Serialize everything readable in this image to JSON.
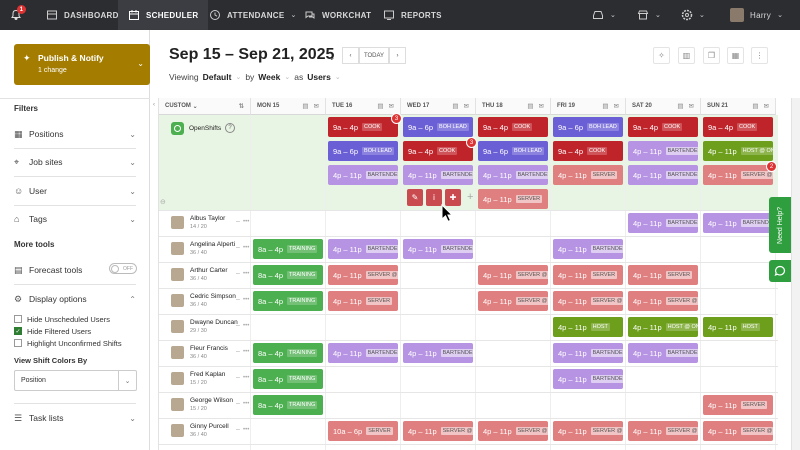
{
  "topbar": {
    "notif_count": "1",
    "nav": [
      {
        "label": "DASHBOARD",
        "icon": "dashboard-icon"
      },
      {
        "label": "SCHEDULER",
        "icon": "scheduler-icon",
        "active": true
      },
      {
        "label": "ATTENDANCE",
        "icon": "attendance-icon"
      },
      {
        "label": "WORKCHAT",
        "icon": "workchat-icon"
      },
      {
        "label": "REPORTS",
        "icon": "reports-icon"
      }
    ],
    "user_name": "Harry"
  },
  "sidebar": {
    "publish_title": "Publish & Notify",
    "publish_sub": "1 change",
    "filters_heading": "Filters",
    "filters": [
      "Positions",
      "Job sites",
      "User",
      "Tags"
    ],
    "more_tools": "More tools",
    "forecast_tools": "Forecast tools",
    "toggle_state": "OFF",
    "display_options": "Display options",
    "checks": [
      {
        "label": "Hide Unscheduled Users",
        "checked": false
      },
      {
        "label": "Hide Filtered Users",
        "checked": true
      },
      {
        "label": "Highlight Unconfirmed Shifts",
        "checked": false
      }
    ],
    "view_colors_label": "View Shift Colors By",
    "view_colors_value": "Position",
    "task_lists": "Task lists"
  },
  "header": {
    "week_title": "Sep 15 – Sep 21, 2025",
    "today": "TODAY",
    "viewing_label": "Viewing",
    "viewing_value": "Default",
    "by_label": "by",
    "by_value": "Week",
    "as_label": "as",
    "as_value": "Users"
  },
  "grid": {
    "first_col": "CUSTOM",
    "days": [
      "MON 15",
      "TUE 16",
      "WED 17",
      "THU 18",
      "FRI 19",
      "SAT 20",
      "SUN 21"
    ],
    "openshifts_label": "OpenShifts",
    "people": [
      {
        "name": "Albus Taylor",
        "hours": "14 / 20"
      },
      {
        "name": "Angelina Alperti",
        "hours": "36 / 40"
      },
      {
        "name": "Arthur Carter",
        "hours": "36 / 40"
      },
      {
        "name": "Cedric Simpson",
        "hours": "36 / 40"
      },
      {
        "name": "Dwayne Duncan",
        "hours": "29 / 30"
      },
      {
        "name": "Fleur Francis",
        "hours": "36 / 40"
      },
      {
        "name": "Fred Kaplan",
        "hours": "15 / 20"
      },
      {
        "name": "George Wilson",
        "hours": "15 / 20"
      },
      {
        "name": "Ginny Purcell",
        "hours": "36 / 40"
      }
    ]
  },
  "shifts": [
    {
      "row": -1,
      "sub": 0,
      "day": 1,
      "time": "9a – 4p",
      "tag": "COOK",
      "color": "cook",
      "badge": "3"
    },
    {
      "row": -1,
      "sub": 0,
      "day": 2,
      "time": "9a – 6p",
      "tag": "BOH LEAD",
      "color": "boh"
    },
    {
      "row": -1,
      "sub": 0,
      "day": 3,
      "time": "9a – 4p",
      "tag": "COOK",
      "color": "cook"
    },
    {
      "row": -1,
      "sub": 0,
      "day": 4,
      "time": "9a – 6p",
      "tag": "BOH LEAD",
      "color": "boh"
    },
    {
      "row": -1,
      "sub": 0,
      "day": 5,
      "time": "9a – 4p",
      "tag": "COOK",
      "color": "cook"
    },
    {
      "row": -1,
      "sub": 0,
      "day": 6,
      "time": "9a – 4p",
      "tag": "COOK",
      "color": "cook"
    },
    {
      "row": -1,
      "sub": 1,
      "day": 1,
      "time": "9a – 6p",
      "tag": "BOH LEAD",
      "color": "boh"
    },
    {
      "row": -1,
      "sub": 1,
      "day": 2,
      "time": "9a – 4p",
      "tag": "COOK",
      "color": "cook",
      "badge": "3"
    },
    {
      "row": -1,
      "sub": 1,
      "day": 3,
      "time": "9a – 6p",
      "tag": "BOH LEAD",
      "color": "boh"
    },
    {
      "row": -1,
      "sub": 1,
      "day": 4,
      "time": "9a – 4p",
      "tag": "COOK",
      "color": "cook"
    },
    {
      "row": -1,
      "sub": 1,
      "day": 5,
      "time": "4p – 11p",
      "tag": "BARTENDER",
      "color": "bart"
    },
    {
      "row": -1,
      "sub": 1,
      "day": 6,
      "time": "4p – 11p",
      "tag": "HOST @ ON",
      "color": "host"
    },
    {
      "row": -1,
      "sub": 2,
      "day": 1,
      "time": "4p – 11p",
      "tag": "BARTENDER",
      "color": "bart"
    },
    {
      "row": -1,
      "sub": 2,
      "day": 2,
      "time": "4p – 11p",
      "tag": "BARTENDER",
      "color": "bart"
    },
    {
      "row": -1,
      "sub": 2,
      "day": 3,
      "time": "4p – 11p",
      "tag": "BARTENDER",
      "color": "bart"
    },
    {
      "row": -1,
      "sub": 2,
      "day": 4,
      "time": "4p – 11p",
      "tag": "SERVER",
      "color": "serv"
    },
    {
      "row": -1,
      "sub": 2,
      "day": 5,
      "time": "4p – 11p",
      "tag": "BARTENDER",
      "color": "bart"
    },
    {
      "row": -1,
      "sub": 2,
      "day": 6,
      "time": "4p – 11p",
      "tag": "SERVER @ O",
      "color": "serv",
      "badge": "2"
    },
    {
      "row": -1,
      "sub": 3,
      "day": 3,
      "time": "4p – 11p",
      "tag": "SERVER",
      "color": "serv"
    },
    {
      "row": 0,
      "day": 5,
      "time": "4p – 11p",
      "tag": "BARTENDER",
      "color": "bart"
    },
    {
      "row": 0,
      "day": 6,
      "time": "4p – 11p",
      "tag": "BARTENDER",
      "color": "bart"
    },
    {
      "row": 1,
      "day": 0,
      "time": "8a – 4p",
      "tag": "TRAINING",
      "color": "train"
    },
    {
      "row": 1,
      "day": 1,
      "time": "4p – 11p",
      "tag": "BARTENDER",
      "color": "bart"
    },
    {
      "row": 1,
      "day": 2,
      "time": "4p – 11p",
      "tag": "BARTENDER",
      "color": "bart"
    },
    {
      "row": 1,
      "day": 4,
      "time": "4p – 11p",
      "tag": "BARTENDER",
      "color": "bart"
    },
    {
      "row": 2,
      "day": 0,
      "time": "8a – 4p",
      "tag": "TRAINING",
      "color": "train"
    },
    {
      "row": 2,
      "day": 1,
      "time": "4p – 11p",
      "tag": "SERVER @ Y",
      "color": "serv"
    },
    {
      "row": 2,
      "day": 3,
      "time": "4p – 11p",
      "tag": "SERVER @ Y",
      "color": "serv"
    },
    {
      "row": 2,
      "day": 4,
      "time": "4p – 11p",
      "tag": "SERVER",
      "color": "serv"
    },
    {
      "row": 2,
      "day": 5,
      "time": "4p – 11p",
      "tag": "SERVER",
      "color": "serv"
    },
    {
      "row": 3,
      "day": 0,
      "time": "8a – 4p",
      "tag": "TRAINING",
      "color": "train"
    },
    {
      "row": 3,
      "day": 1,
      "time": "4p – 11p",
      "tag": "SERVER",
      "color": "serv"
    },
    {
      "row": 3,
      "day": 3,
      "time": "4p – 11p",
      "tag": "SERVER @ Y",
      "color": "serv"
    },
    {
      "row": 3,
      "day": 4,
      "time": "4p – 11p",
      "tag": "SERVER @ Y",
      "color": "serv"
    },
    {
      "row": 3,
      "day": 5,
      "time": "4p – 11p",
      "tag": "SERVER @ Y",
      "color": "serv"
    },
    {
      "row": 4,
      "day": 4,
      "time": "4p – 11p",
      "tag": "HOST",
      "color": "host"
    },
    {
      "row": 4,
      "day": 5,
      "time": "4p – 11p",
      "tag": "HOST @ ON",
      "color": "host"
    },
    {
      "row": 4,
      "day": 6,
      "time": "4p – 11p",
      "tag": "HOST",
      "color": "host"
    },
    {
      "row": 5,
      "day": 0,
      "time": "8a – 4p",
      "tag": "TRAINING",
      "color": "train"
    },
    {
      "row": 5,
      "day": 1,
      "time": "4p – 11p",
      "tag": "BARTENDER",
      "color": "bart"
    },
    {
      "row": 5,
      "day": 2,
      "time": "4p – 11p",
      "tag": "BARTENDER",
      "color": "bart"
    },
    {
      "row": 5,
      "day": 4,
      "time": "4p – 11p",
      "tag": "BARTENDER",
      "color": "bart"
    },
    {
      "row": 5,
      "day": 5,
      "time": "4p – 11p",
      "tag": "BARTENDER",
      "color": "bart"
    },
    {
      "row": 6,
      "day": 0,
      "time": "8a – 4p",
      "tag": "TRAINING",
      "color": "train"
    },
    {
      "row": 6,
      "day": 4,
      "time": "4p – 11p",
      "tag": "BARTENDER",
      "color": "bart"
    },
    {
      "row": 7,
      "day": 0,
      "time": "8a – 4p",
      "tag": "TRAINING",
      "color": "train"
    },
    {
      "row": 7,
      "day": 6,
      "time": "4p – 11p",
      "tag": "SERVER",
      "color": "serv"
    },
    {
      "row": 8,
      "day": 1,
      "time": "10a – 6p",
      "tag": "SERVER",
      "color": "serv"
    },
    {
      "row": 8,
      "day": 2,
      "time": "4p – 11p",
      "tag": "SERVER @ Y",
      "color": "serv"
    },
    {
      "row": 8,
      "day": 3,
      "time": "4p – 11p",
      "tag": "SERVER @ Y",
      "color": "serv"
    },
    {
      "row": 8,
      "day": 4,
      "time": "4p – 11p",
      "tag": "SERVER @ Y",
      "color": "serv"
    },
    {
      "row": 8,
      "day": 5,
      "time": "4p – 11p",
      "tag": "SERVER @ Y",
      "color": "serv"
    },
    {
      "row": 8,
      "day": 6,
      "time": "4p – 11p",
      "tag": "SERVER @ Y",
      "color": "serv"
    }
  ],
  "help": {
    "need_help": "Need Help?"
  }
}
